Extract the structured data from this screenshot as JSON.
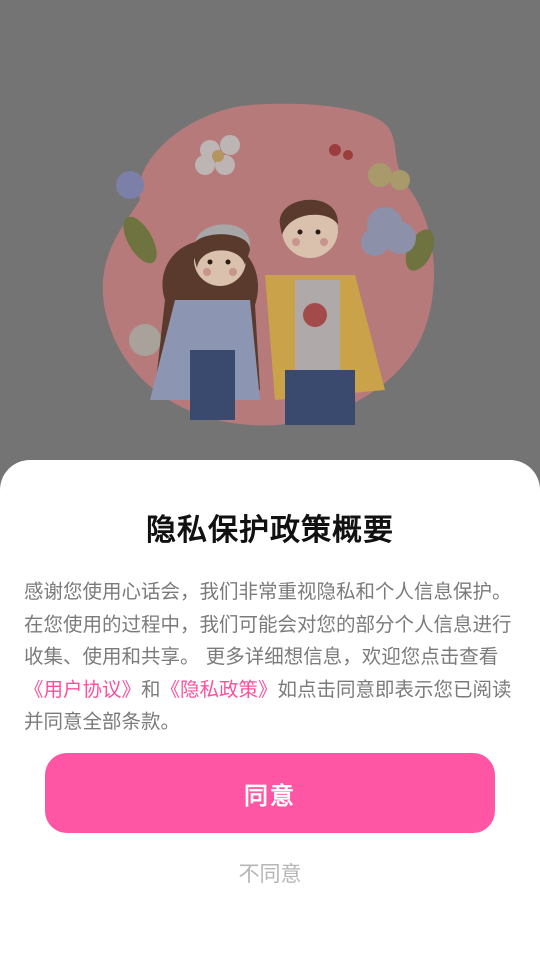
{
  "colors": {
    "overlay": "#747474",
    "accent": "#ff55a5",
    "link": "#ff4f9c",
    "text_body": "#7b7b7b",
    "title": "#111111"
  },
  "illustration": {
    "icon": "couple-illustration"
  },
  "dialog": {
    "title": "隐私保护政策概要",
    "body_part1": "感谢您使用心话会，我们非常重视隐私和个人信息保护。 在您使用的过程中，我们可能会对您的部分个人信息进行收集、使用和共享。 更多详细想信息，欢迎您点击查看",
    "user_agreement_link": "《用户协议》",
    "connector": "和",
    "privacy_policy_link": "《隐私政策》",
    "body_part2": "如点击同意即表示您已阅读并同意全部条款。",
    "agree_label": "同意",
    "disagree_label": "不同意"
  }
}
